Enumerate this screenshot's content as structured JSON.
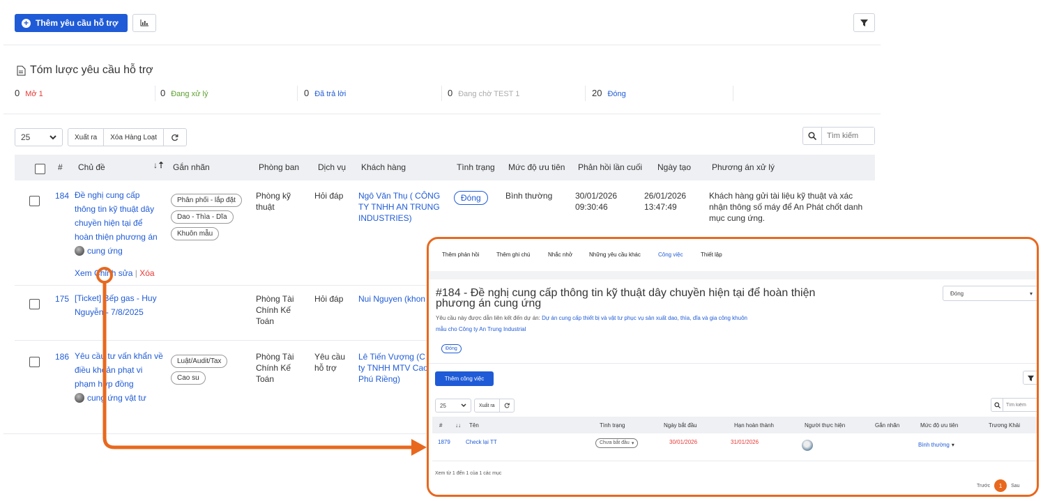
{
  "toolbar": {
    "add_label": "Thêm yêu cầu hỗ trợ"
  },
  "summary": {
    "title": "Tóm lược yêu cầu hỗ trợ",
    "items": [
      {
        "count": "0",
        "label": "Mở 1",
        "color": "#e53935"
      },
      {
        "count": "0",
        "label": "Đang xử lý",
        "color": "#5aa02c"
      },
      {
        "count": "0",
        "label": "Đã trả lời",
        "color": "#1f5bd6"
      },
      {
        "count": "0",
        "label": "Đang chờ TEST 1",
        "color": "#aaaaaa"
      },
      {
        "count": "20",
        "label": "Đóng",
        "color": "#1f5bd6"
      }
    ]
  },
  "table_controls": {
    "page_size": "25",
    "export": "Xuất ra",
    "bulk_delete": "Xóa Hàng Loạt",
    "search_placeholder": "Tìm kiếm"
  },
  "columns": [
    "#",
    "Chủ đề",
    "Gắn nhãn",
    "Phòng ban",
    "Dịch vụ",
    "Khách hàng",
    "Tình trạng",
    "Mức độ ưu tiên",
    "Phản hồi lần cuối",
    "Ngày tạo",
    "Phương án xử lý"
  ],
  "rows": [
    {
      "id": "184",
      "title": [
        "Đề nghị cung cấp",
        "thông tin kỹ thuật dây",
        "chuyền hiện tại để",
        "hoàn thiện phương án"
      ],
      "title_tail": "cung ứng",
      "actions": {
        "view": "Xem",
        "edit": "Chỉnh sửa",
        "sep": "|",
        "delete": "Xóa"
      },
      "tags": [
        "Phân phối - lắp đặt",
        "Dao - Thìa - Dĩa",
        "Khuôn mẫu"
      ],
      "department": [
        "Phòng kỹ",
        "thuật"
      ],
      "service": "Hỏi đáp",
      "customer": [
        "Ngô Văn Thụ ( CÔNG",
        "TY TNHH AN TRUNG",
        "INDUSTRIES)"
      ],
      "status": "Đóng",
      "priority": "Bình thường",
      "last_reply": [
        "30/01/2026",
        "09:30:46"
      ],
      "created": [
        "26/01/2026",
        "13:47:49"
      ],
      "solution": [
        "Khách hàng gửi tài liệu kỹ thuật và xác",
        "nhận thông số máy để An Phát chốt danh",
        "mục cung ứng."
      ]
    },
    {
      "id": "175",
      "title": [
        "[Ticket] Bếp gas - Huy",
        "Nguyễn - 7/8/2025"
      ],
      "department": [
        "Phòng Tài",
        "Chính Kế",
        "Toán"
      ],
      "service": "Hỏi đáp",
      "customer": [
        "Nui Nguyen (khon"
      ]
    },
    {
      "id": "186",
      "title": [
        "Yêu cầu tư vấn khẩn về",
        "điều khoản phạt vi",
        "phạm hợp đồng"
      ],
      "title_tail": "cung ứng vật tư",
      "tags": [
        "Luật/Audit/Tax",
        "Cao su"
      ],
      "department": [
        "Phòng Tài",
        "Chính Kế",
        "Toán"
      ],
      "service": [
        "Yêu cầu",
        "hỗ trợ"
      ],
      "customer": [
        "Lê Tiến Vượng (C",
        "ty TNHH MTV Cao",
        "Phú Riềng)"
      ]
    }
  ],
  "popup": {
    "tabs": [
      "Thêm phản hồi",
      "Thêm ghi chú",
      "Nhắc nhở",
      "Những yêu cầu khác",
      "Công việc",
      "Thiết lập"
    ],
    "active_tab": "Công việc",
    "title_line1": "#184 - Đề nghị cung cấp thông tin kỹ thuật dây chuyền hiện tại để hoàn thiện",
    "title_line2": "phương án cung ứng",
    "status_select": "Đóng",
    "project_prefix": "Yêu cầu này được dẫn liên kết đến dự án:",
    "project_link_1": "Dự án cung cấp thiết bị và vật tư phục vụ sản xuất dao, thìa, dĩa và gia công khuôn",
    "project_link_2": "mẫu cho Công ty An Trung Industrial",
    "badge": "Đóng",
    "add_task": "Thêm công việc",
    "page_size": "25",
    "export": "Xuất ra",
    "search_placeholder": "Tìm kiếm",
    "columns": [
      "#",
      "Tên",
      "Tình trạng",
      "Ngày bắt đầu",
      "Hạn hoàn thành",
      "Người thực hiện",
      "Gắn nhãn",
      "Mức độ ưu tiên",
      "Trương Khải"
    ],
    "task": {
      "id": "1879",
      "name": "Check lại TT",
      "status": "Chưa bắt đầu",
      "start": "30/01/2026",
      "due": "31/01/2026",
      "priority": "Bình thường"
    },
    "footer": "Xem từ 1 đến 1 của 1 các mục",
    "pager": {
      "prev": "Trước",
      "current": "1",
      "next": "Sau"
    }
  },
  "colors": {
    "accent": "#1f5bd6",
    "highlight": "#e8681e",
    "danger": "#e53935"
  }
}
